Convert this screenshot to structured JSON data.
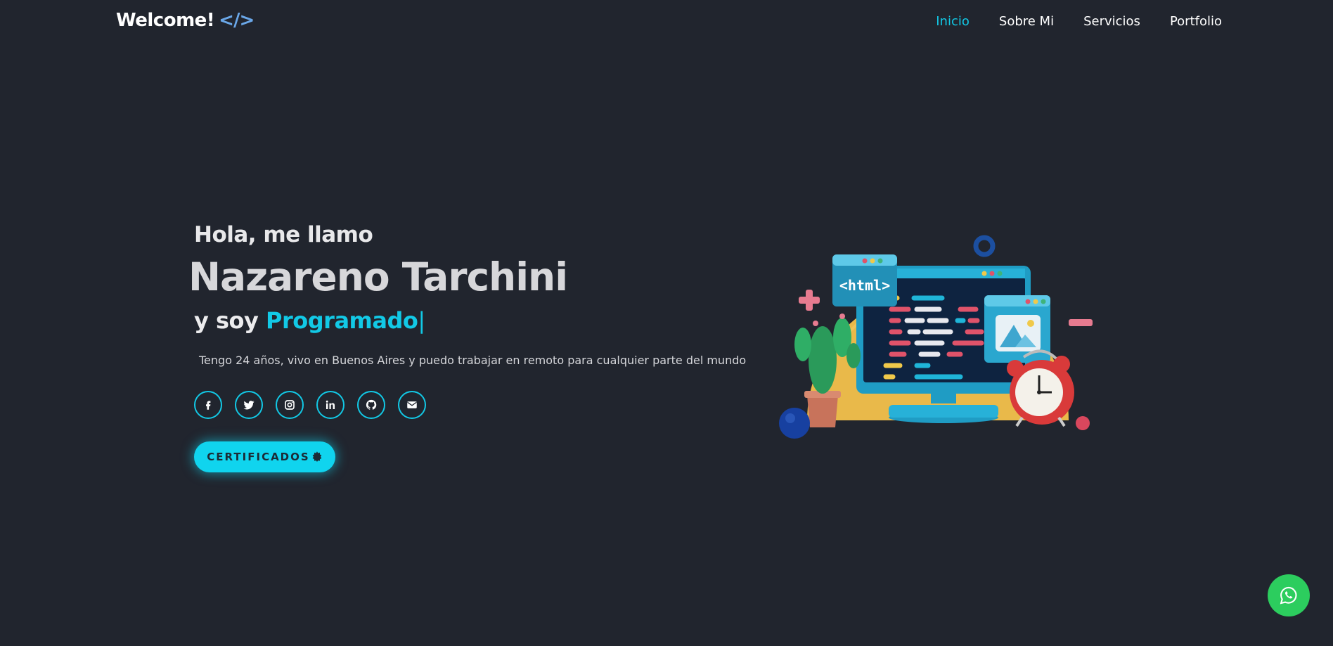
{
  "header": {
    "logo_text": "Welcome!",
    "logo_code": "</>",
    "nav": [
      {
        "label": "Inicio",
        "active": true
      },
      {
        "label": "Sobre Mi",
        "active": false
      },
      {
        "label": "Servicios",
        "active": false
      },
      {
        "label": "Portfolio",
        "active": false
      }
    ]
  },
  "hero": {
    "greeting": "Hola, me llamo",
    "name": "Nazareno Tarchini",
    "role_prefix": "y soy",
    "role_typed": "Programado",
    "cursor": "|",
    "description": "Tengo 24 años, vivo en Buenos Aires y puedo trabajar en remoto para cualquier parte del mundo",
    "socials": [
      "facebook-icon",
      "twitter-icon",
      "instagram-icon",
      "linkedin-icon",
      "github-icon",
      "email-icon"
    ],
    "cert_button": "CERTIFICADOS"
  },
  "illustration": {
    "html_tag": "<html>"
  },
  "colors": {
    "background": "#21252e",
    "accent": "#12c9e6",
    "whatsapp": "#2ccd5e",
    "logo_code": "#6aa7e8"
  },
  "floating": {
    "whatsapp_icon": "whatsapp-icon"
  }
}
